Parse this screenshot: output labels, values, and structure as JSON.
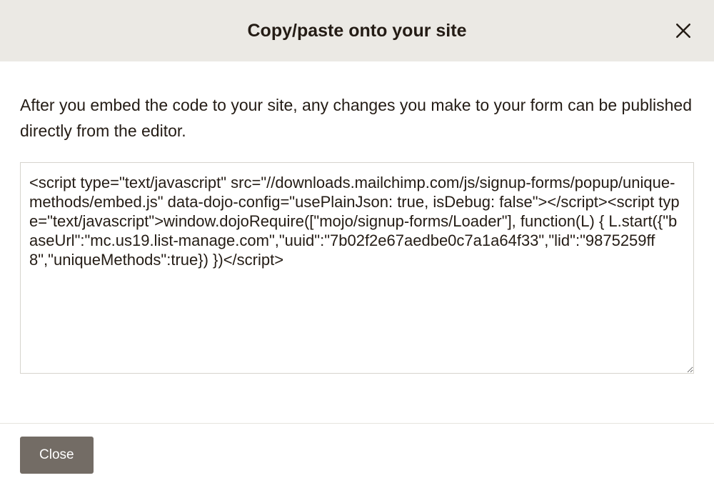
{
  "modal": {
    "title": "Copy/paste onto your site",
    "description": "After you embed the code to your site, any changes you make to your form can be published directly from the editor.",
    "code_content": "<script type=\"text/javascript\" src=\"//downloads.mailchimp.com/js/signup-forms/popup/unique-methods/embed.js\" data-dojo-config=\"usePlainJson: true, isDebug: false\"></script><script type=\"text/javascript\">window.dojoRequire([\"mojo/signup-forms/Loader\"], function(L) { L.start({\"baseUrl\":\"mc.us19.list-manage.com\",\"uuid\":\"7b02f2e67aedbe0c7a1a64f33\",\"lid\":\"9875259ff8\",\"uniqueMethods\":true}) })</script>",
    "close_button_label": "Close"
  }
}
